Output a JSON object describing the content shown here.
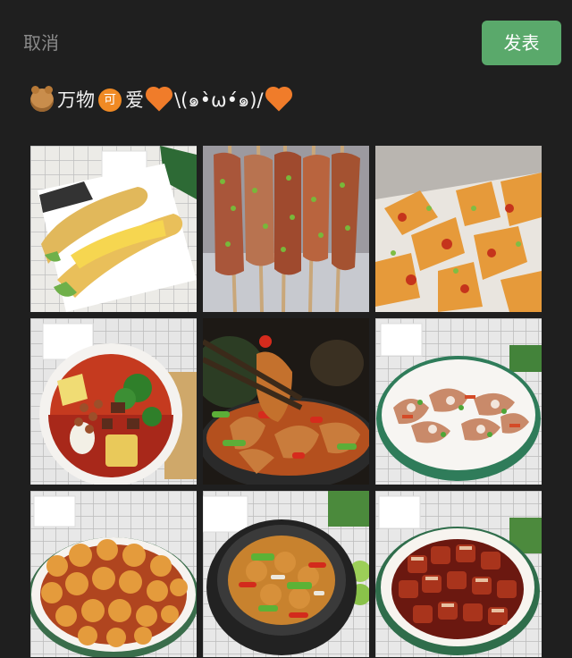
{
  "header": {
    "cancel_label": "取消",
    "publish_label": "发表",
    "publish_color": "#5aa96b"
  },
  "post": {
    "segments": [
      {
        "type": "icon",
        "name": "bear-emoji-icon"
      },
      {
        "type": "text",
        "value": "万物"
      },
      {
        "type": "icon",
        "name": "ke-emoji-icon",
        "glyph": "可"
      },
      {
        "type": "text",
        "value": "爱"
      },
      {
        "type": "icon",
        "name": "orange-heart-icon"
      },
      {
        "type": "text",
        "value": "\\(๑•̀ω•́๑)/"
      },
      {
        "type": "icon",
        "name": "orange-heart-icon"
      }
    ]
  },
  "photos": [
    {
      "name": "photo-egg-pancake"
    },
    {
      "name": "photo-grilled-skewers"
    },
    {
      "name": "photo-spicy-potatoes"
    },
    {
      "name": "photo-beef-noodle-soup"
    },
    {
      "name": "photo-chopsticks-stew"
    },
    {
      "name": "photo-pig-ear-salad"
    },
    {
      "name": "photo-sweet-sour-pork"
    },
    {
      "name": "photo-claypot-chicken"
    },
    {
      "name": "photo-braised-pork"
    }
  ]
}
